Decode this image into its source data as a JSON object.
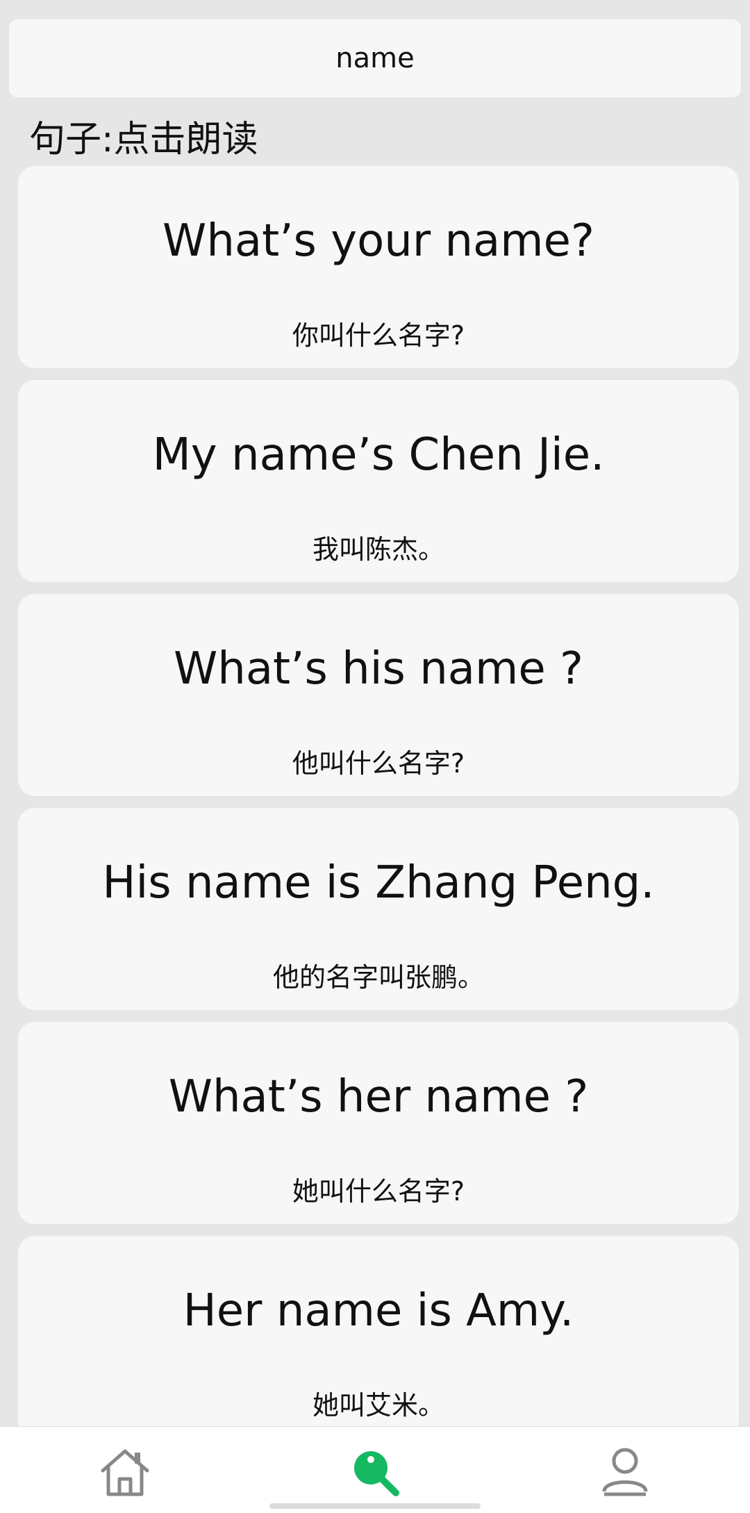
{
  "header": {
    "title": "name"
  },
  "section": {
    "label": "句子:点击朗读"
  },
  "sentences": [
    {
      "en": "What’s your name?",
      "zh": "你叫什么名字?"
    },
    {
      "en": "My name’s Chen Jie.",
      "zh": "我叫陈杰。"
    },
    {
      "en": "What’s his name ?",
      "zh": "他叫什么名字?"
    },
    {
      "en": "His name is Zhang Peng.",
      "zh": "他的名字叫张鹏。"
    },
    {
      "en": "What’s her name ?",
      "zh": "她叫什么名字?"
    },
    {
      "en": "Her name is Amy.",
      "zh": "她叫艾米。"
    }
  ],
  "bottom_nav": {
    "items": [
      {
        "icon": "home-icon",
        "color": "#888888"
      },
      {
        "icon": "search-icon",
        "color": "#16b861",
        "active": true
      },
      {
        "icon": "profile-icon",
        "color": "#888888"
      }
    ]
  }
}
